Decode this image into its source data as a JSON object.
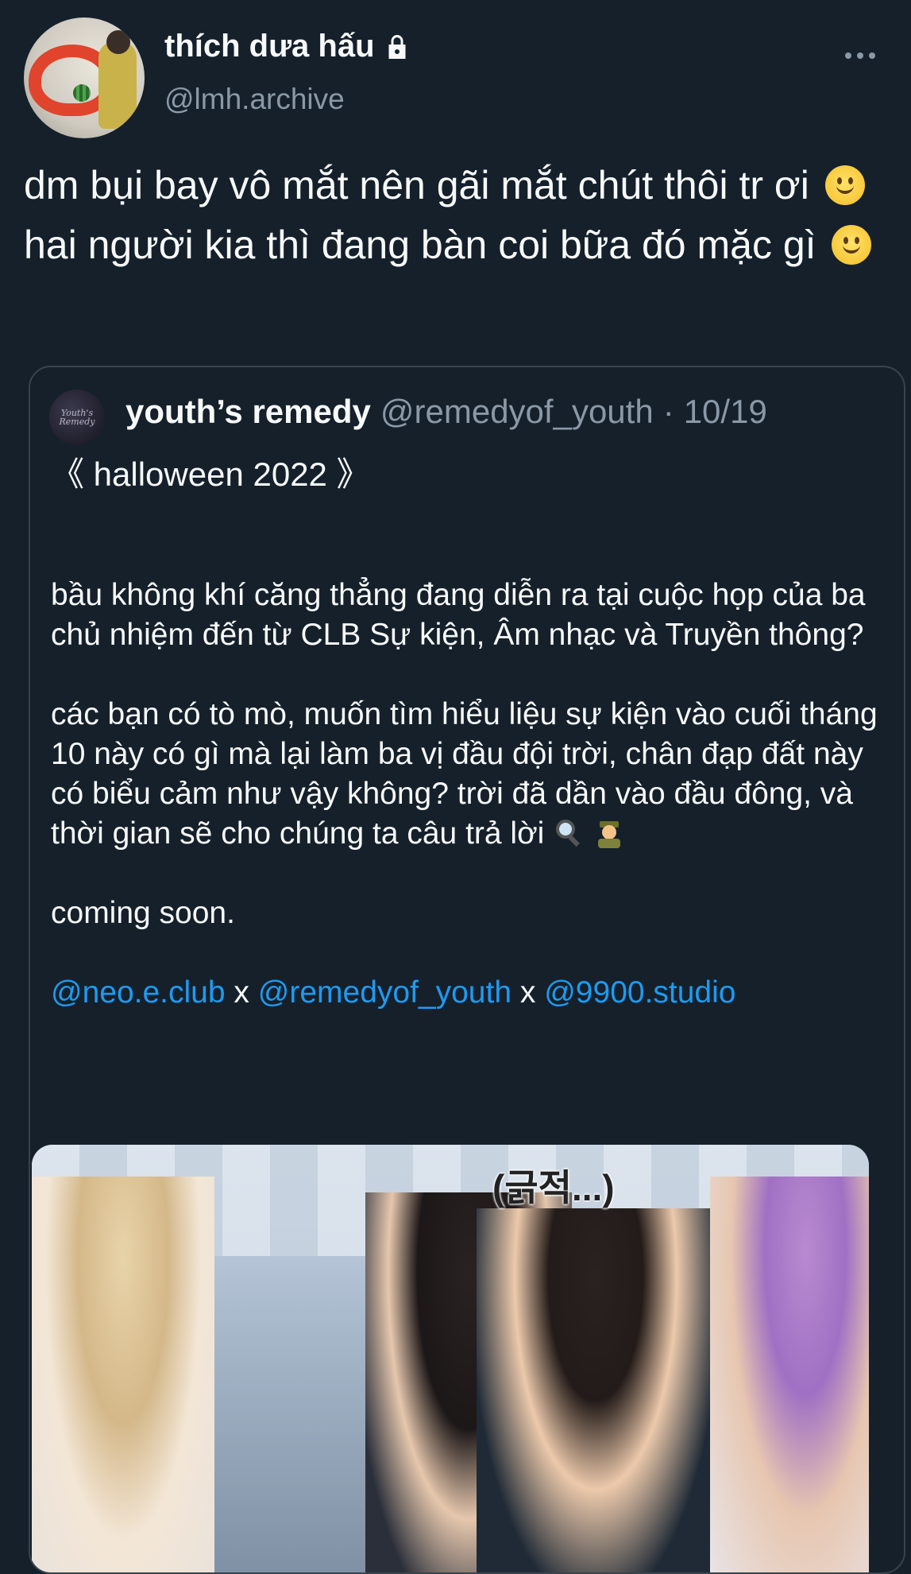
{
  "author": {
    "display_name": "thích dưa hấu",
    "handle": "@lmh.archive",
    "protected_icon": "lock-icon"
  },
  "tweet": {
    "text_1": "dm bụi bay vô mắt nên gãi mắt chút thôi tr ơi",
    "text_2": "hai người kia thì đang bàn coi bữa đó mặc gì",
    "emoji": "slightly-smiling-face"
  },
  "quoted": {
    "name": "youth’s remedy",
    "handle": "@remedyof_youth",
    "dot": "·",
    "date": "10/19",
    "avatar_text": "Youth's Remedy",
    "title": "《 halloween 2022 》",
    "para_1": "bầu không khí căng thẳng đang diễn ra tại cuộc họp của ba chủ nhiệm đến từ CLB Sự kiện, Âm nhạc và Truyền thông?",
    "para_2": "các bạn có tò mò, muốn tìm hiểu liệu sự kiện vào cuối tháng 10 này có gì mà lại làm ba vị đầu đội trời, chân đạp đất này có biểu cảm như vậy không? trời đã dần vào đầu đông, và thời gian sẽ cho chúng ta câu trả lời",
    "para_3": "coming soon.",
    "mentions": [
      "@neo.e.club",
      "@remedyof_youth",
      "@9900.studio"
    ],
    "separator": "x",
    "media_caption": "(긁적...)"
  },
  "colors": {
    "background": "#15202b",
    "text": "#f7f9f9",
    "secondary": "#8b98a5",
    "link": "#1d9bf0",
    "border": "#38444d"
  }
}
